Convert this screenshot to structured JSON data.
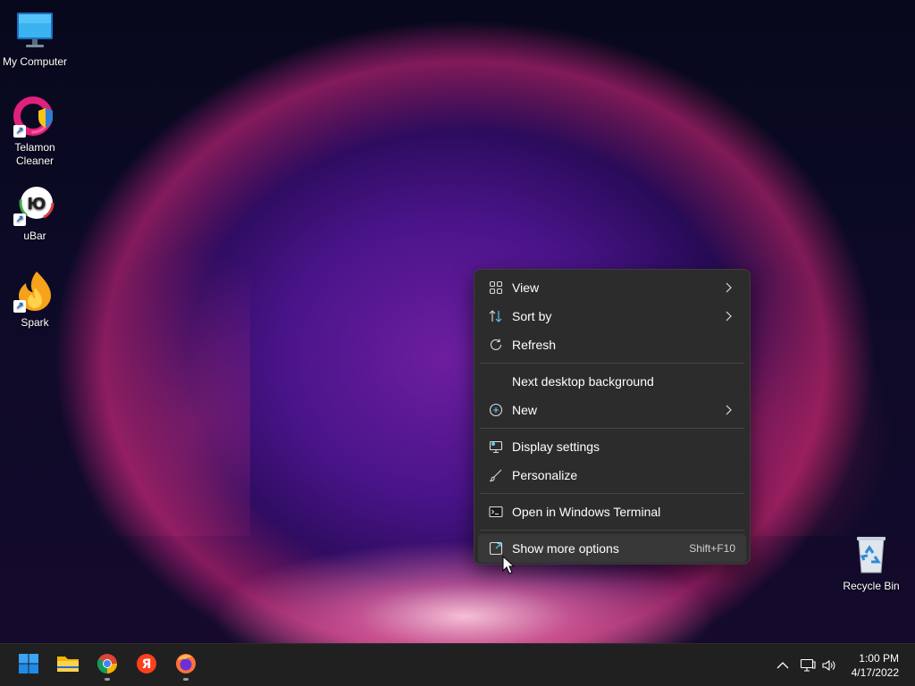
{
  "desktop": {
    "icons": [
      {
        "label": "My Computer",
        "icon": "monitor-icon"
      },
      {
        "label": "Telamon Cleaner",
        "icon": "telamon-cleaner-icon"
      },
      {
        "label": "uBar",
        "icon": "ubar-icon"
      },
      {
        "label": "Spark",
        "icon": "spark-icon"
      },
      {
        "label": "Recycle Bin",
        "icon": "recycle-bin-icon"
      }
    ]
  },
  "context_menu": {
    "items": [
      {
        "label": "View",
        "icon": "grid-icon",
        "submenu": true
      },
      {
        "label": "Sort by",
        "icon": "sort-arrows-icon",
        "submenu": true
      },
      {
        "label": "Refresh",
        "icon": "refresh-icon",
        "submenu": false
      },
      {
        "label": "Next desktop background",
        "icon": "",
        "submenu": false
      },
      {
        "label": "New",
        "icon": "plus-circle-icon",
        "submenu": true
      },
      {
        "label": "Display settings",
        "icon": "display-settings-icon",
        "submenu": false
      },
      {
        "label": "Personalize",
        "icon": "brush-icon",
        "submenu": false
      },
      {
        "label": "Open in Windows Terminal",
        "icon": "terminal-icon",
        "submenu": false
      },
      {
        "label": "Show more options",
        "icon": "expand-icon",
        "shortcut": "Shift+F10",
        "hovered": true
      }
    ]
  },
  "taskbar": {
    "apps": [
      {
        "name": "start-button",
        "icon": "windows-logo-icon"
      },
      {
        "name": "file-explorer",
        "icon": "folder-icon"
      },
      {
        "name": "chrome",
        "icon": "chrome-icon",
        "running": true
      },
      {
        "name": "yandex",
        "icon": "yandex-icon"
      },
      {
        "name": "firefox",
        "icon": "firefox-icon",
        "running": true
      }
    ],
    "tray": {
      "time": "1:00 PM",
      "date": "4/17/2022"
    }
  },
  "colors": {
    "menu_bg": "#2c2c2c",
    "taskbar_bg": "#202020",
    "accent": "#60cdff"
  }
}
